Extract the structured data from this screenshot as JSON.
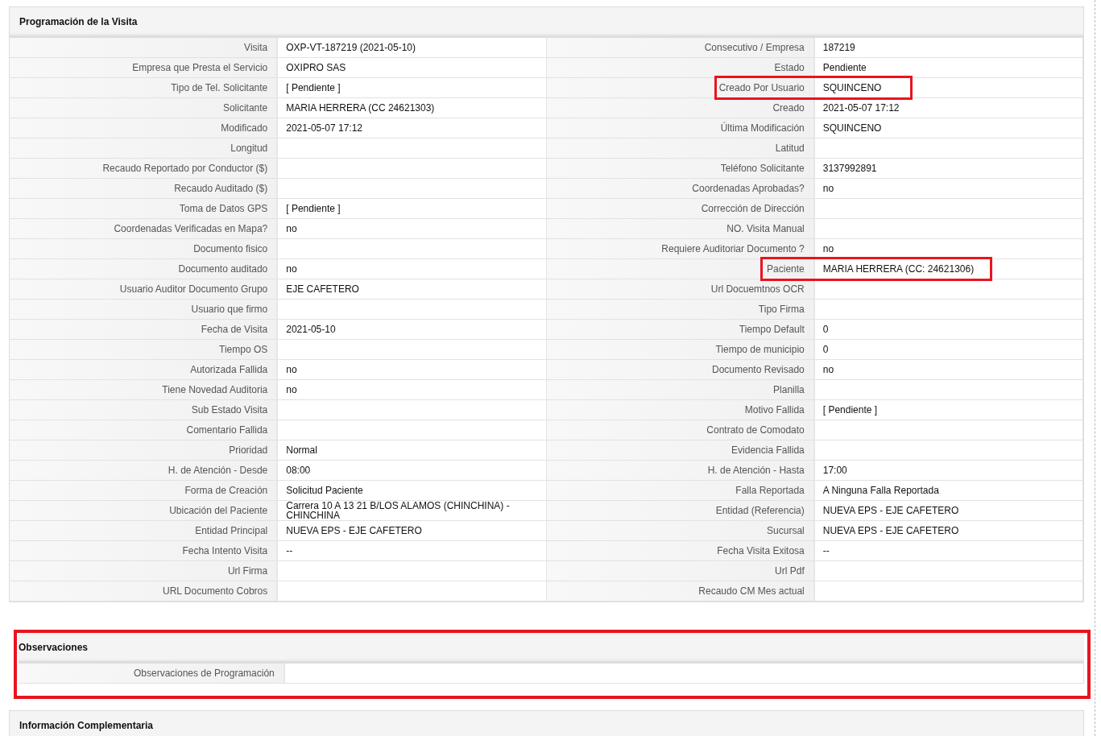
{
  "sections": [
    {
      "title": "Programación de la Visita",
      "highlighted": false,
      "rows": [
        [
          {
            "label": "Visita",
            "value": "OXP-VT-187219 (2021-05-10)",
            "highlighted": false
          },
          {
            "label": "Consecutivo / Empresa",
            "value": "187219",
            "highlighted": false
          }
        ],
        [
          {
            "label": "Empresa que Presta el Servicio",
            "value": "OXIPRO SAS",
            "highlighted": false
          },
          {
            "label": "Estado",
            "value": "Pendiente",
            "highlighted": false
          }
        ],
        [
          {
            "label": "Tipo de Tel. Solicitante",
            "value": "[ Pendiente ]",
            "highlighted": false
          },
          {
            "label": "Creado Por Usuario",
            "value": "SQUINCENO",
            "highlighted": true
          }
        ],
        [
          {
            "label": "Solicitante",
            "value": "MARIA HERRERA (CC 24621303)",
            "highlighted": false
          },
          {
            "label": "Creado",
            "value": "2021-05-07 17:12",
            "highlighted": false
          }
        ],
        [
          {
            "label": "Modificado",
            "value": "2021-05-07 17:12",
            "highlighted": false
          },
          {
            "label": "Última Modificación",
            "value": "SQUINCENO",
            "highlighted": false
          }
        ],
        [
          {
            "label": "Longitud",
            "highlighted": false
          },
          {
            "label": "Latitud",
            "highlighted": false
          }
        ],
        [
          {
            "label": "Recaudo Reportado por Conductor ($)",
            "highlighted": false
          },
          {
            "label": "Teléfono Solicitante",
            "value": "3137992891",
            "highlighted": false
          }
        ],
        [
          {
            "label": "Recaudo Auditado ($)",
            "highlighted": false
          },
          {
            "label": "Coordenadas Aprobadas?",
            "value": "no",
            "highlighted": false
          }
        ],
        [
          {
            "label": "Toma de Datos GPS",
            "value": "[ Pendiente ]",
            "highlighted": false
          },
          {
            "label": "Corrección de Dirección",
            "highlighted": false
          }
        ],
        [
          {
            "label": "Coordenadas Verificadas en Mapa?",
            "value": "no",
            "highlighted": false
          },
          {
            "label": "NO. Visita Manual",
            "highlighted": false
          }
        ],
        [
          {
            "label": "Documento fisico",
            "highlighted": false
          },
          {
            "label": "Requiere Auditoriar Documento ?",
            "value": "no",
            "highlighted": false
          }
        ],
        [
          {
            "label": "Documento auditado",
            "value": "no",
            "highlighted": false
          },
          {
            "label": "Paciente",
            "value": "MARIA HERRERA (CC: 24621306)",
            "highlighted": true
          }
        ],
        [
          {
            "label": "Usuario Auditor Documento Grupo",
            "value": "EJE CAFETERO",
            "highlighted": false
          },
          {
            "label": "Url Docuemtnos OCR",
            "highlighted": false
          }
        ],
        [
          {
            "label": "Usuario que firmo",
            "highlighted": false
          },
          {
            "label": "Tipo Firma",
            "highlighted": false
          }
        ],
        [
          {
            "label": "Fecha de Visita",
            "value": "2021-05-10",
            "highlighted": false
          },
          {
            "label": "Tiempo Default",
            "value": "0",
            "highlighted": false
          }
        ],
        [
          {
            "label": "Tiempo OS",
            "highlighted": false
          },
          {
            "label": "Tiempo de municipio",
            "value": "0",
            "highlighted": false
          }
        ],
        [
          {
            "label": "Autorizada Fallida",
            "value": "no",
            "highlighted": false
          },
          {
            "label": "Documento Revisado",
            "value": "no",
            "highlighted": false
          }
        ],
        [
          {
            "label": "Tiene Novedad Auditoria",
            "value": "no",
            "highlighted": false
          },
          {
            "label": "Planilla",
            "highlighted": false
          }
        ],
        [
          {
            "label": "Sub Estado Visita",
            "highlighted": false
          },
          {
            "label": "Motivo Fallida",
            "value": "[ Pendiente ]",
            "highlighted": false
          }
        ],
        [
          {
            "label": "Comentario Fallida",
            "highlighted": false
          },
          {
            "label": "Contrato de Comodato",
            "highlighted": false
          }
        ],
        [
          {
            "label": "Prioridad",
            "value": "Normal",
            "highlighted": false
          },
          {
            "label": "Evidencia Fallida",
            "highlighted": false
          }
        ],
        [
          {
            "label": "H. de Atención - Desde",
            "value": "08:00",
            "highlighted": false
          },
          {
            "label": "H. de Atención - Hasta",
            "value": "17:00",
            "highlighted": false
          }
        ],
        [
          {
            "label": "Forma de Creación",
            "value": "Solicitud Paciente",
            "highlighted": false
          },
          {
            "label": "Falla Reportada",
            "value": "A Ninguna Falla Reportada",
            "highlighted": false
          }
        ],
        [
          {
            "label": "Ubicación del Paciente",
            "value": "Carrera 10 A 13 21 B/LOS ALAMOS (CHINCHINA) - CHINCHINA",
            "highlighted": false
          },
          {
            "label": "Entidad (Referencia)",
            "value": "NUEVA EPS - EJE CAFETERO",
            "highlighted": false
          }
        ],
        [
          {
            "label": "Entidad Principal",
            "value": "NUEVA EPS - EJE CAFETERO",
            "highlighted": false
          },
          {
            "label": "Sucursal",
            "value": "NUEVA EPS - EJE CAFETERO",
            "highlighted": false
          }
        ],
        [
          {
            "label": "Fecha Intento Visita",
            "value": "--",
            "highlighted": false
          },
          {
            "label": "Fecha Visita Exitosa",
            "value": "--",
            "highlighted": false
          }
        ],
        [
          {
            "label": "Url Firma",
            "highlighted": false
          },
          {
            "label": "Url Pdf",
            "highlighted": false
          }
        ],
        [
          {
            "label": "URL Documento Cobros",
            "highlighted": false
          },
          {
            "label": "Recaudo CM Mes actual",
            "highlighted": false
          }
        ]
      ]
    },
    {
      "title": "Observaciones",
      "highlighted": true,
      "rows": [
        [
          {
            "label": "Observaciones de Programación",
            "highlighted": false
          }
        ]
      ]
    },
    {
      "title": "Información Complementaria",
      "highlighted": false
    }
  ]
}
